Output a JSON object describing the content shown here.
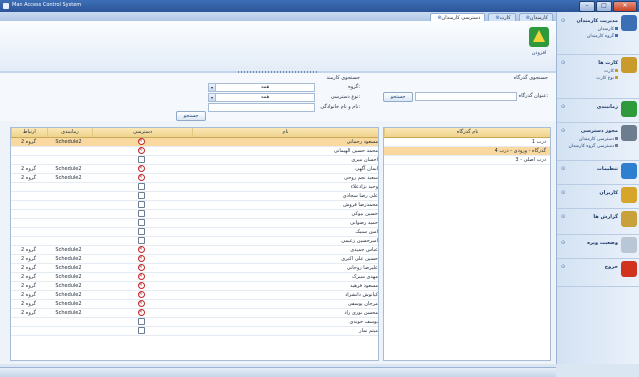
{
  "window": {
    "title": "Man Access Control System"
  },
  "tabs": [
    {
      "label": "کارمندان"
    },
    {
      "label": "کارت"
    },
    {
      "label": "دسترسی کارمندان"
    }
  ],
  "ribbon": {
    "button_label": "افزودن"
  },
  "filters": {
    "employee_section": "جستجوی کارمند",
    "gate_section": "جستجوی گذرگاه",
    "group_label": "گروه:",
    "group_value": "همه",
    "access_label": "نوع دسترسی:",
    "access_value": "همه",
    "name_label": "نام و نام خانوادگی:",
    "search_label": "جستجو",
    "gate_title_label": "عنوان گذرگاه:",
    "gate_search_label": "جستجو"
  },
  "grid": {
    "columns": [
      "ارتباط",
      "زمانبندی",
      "دسترسی",
      "نام"
    ],
    "rows": [
      {
        "group": "گروه 2",
        "schedule": "Schedule2",
        "blocked": true,
        "name": "مسعود رحمانی",
        "selected": true
      },
      {
        "group": "",
        "schedule": "",
        "blocked": true,
        "name": "محمد حسین الهیمانی"
      },
      {
        "group": "",
        "schedule": "",
        "blocked": false,
        "name": "احسان میری"
      },
      {
        "group": "گروه 2",
        "schedule": "Schedule2",
        "blocked": true,
        "name": "ایمان آگهی"
      },
      {
        "group": "گروه 2",
        "schedule": "Schedule2",
        "blocked": true,
        "name": "سعید نجم روحی"
      },
      {
        "group": "",
        "schedule": "",
        "blocked": false,
        "name": "وحید نژادعلاء"
      },
      {
        "group": "",
        "schedule": "",
        "blocked": false,
        "name": "علی رضا سجادی"
      },
      {
        "group": "",
        "schedule": "",
        "blocked": false,
        "name": "محمدرضا فروش"
      },
      {
        "group": "",
        "schedule": "",
        "blocked": false,
        "name": "حسین بیوکی"
      },
      {
        "group": "",
        "schedule": "",
        "blocked": false,
        "name": "حمید رضوانی"
      },
      {
        "group": "",
        "schedule": "",
        "blocked": false,
        "name": "امین سبیک"
      },
      {
        "group": "",
        "schedule": "",
        "blocked": false,
        "name": "امیرحسین زعیمی"
      },
      {
        "group": "گروه 2",
        "schedule": "Schedule2",
        "blocked": true,
        "name": "عباس حمیدی"
      },
      {
        "group": "گروه 2",
        "schedule": "Schedule2",
        "blocked": true,
        "name": "حسین علی اکبری"
      },
      {
        "group": "گروه 2",
        "schedule": "Schedule2",
        "blocked": true,
        "name": "علیرضا روحانی"
      },
      {
        "group": "گروه 2",
        "schedule": "Schedule2",
        "blocked": true,
        "name": "مهدی سیرک"
      },
      {
        "group": "گروه 2",
        "schedule": "Schedule2",
        "blocked": true,
        "name": "مسعود فرهید"
      },
      {
        "group": "گروه 2",
        "schedule": "Schedule2",
        "blocked": true,
        "name": "کیانوش دانشزاد"
      },
      {
        "group": "گروه 2",
        "schedule": "Schedule2",
        "blocked": true,
        "name": "مرجان یوسفی"
      },
      {
        "group": "گروه 2",
        "schedule": "Schedule2",
        "blocked": true,
        "name": "محسن نوری راد"
      },
      {
        "group": "",
        "schedule": "",
        "blocked": false,
        "name": "یوسف خوندی"
      },
      {
        "group": "",
        "schedule": "",
        "blocked": false,
        "name": "میثم نمار"
      }
    ]
  },
  "gates": {
    "column": "نام گذرگاه",
    "rows": [
      {
        "name": "درب 1",
        "selected": false
      },
      {
        "name": "گذرگاه - ورودی - درب 4",
        "selected": true
      },
      {
        "name": "درب اصلی - 3",
        "selected": false
      }
    ]
  },
  "sidebar": {
    "items": [
      {
        "title": "مدیریت کارمندان",
        "subs": [
          "کارمندان",
          "گروه کارمندان"
        ],
        "color": "#3a6fb5"
      },
      {
        "title": "کارت ها",
        "subs": [
          "کارت",
          "نوع کارت"
        ],
        "color": "#c99a2c"
      },
      {
        "title": "زمانبندی",
        "subs": [],
        "color": "#2f9a3c"
      },
      {
        "title": "مجوز دسترسی",
        "subs": [
          "دسترسی کارمندان",
          "دسترسی گروه کارمندان"
        ],
        "color": "#6d7d90"
      },
      {
        "title": "تنظیمات",
        "subs": [],
        "color": "#2f7fd0"
      },
      {
        "title": "کاربران",
        "subs": [],
        "color": "#d7a52a"
      },
      {
        "title": "گزارش ها",
        "subs": [],
        "color": "#c9a13a"
      },
      {
        "title": "وضعیت ویره",
        "subs": [],
        "color": "#b8c6d6"
      },
      {
        "title": "خروج",
        "subs": [],
        "color": "#d1341e"
      }
    ]
  }
}
